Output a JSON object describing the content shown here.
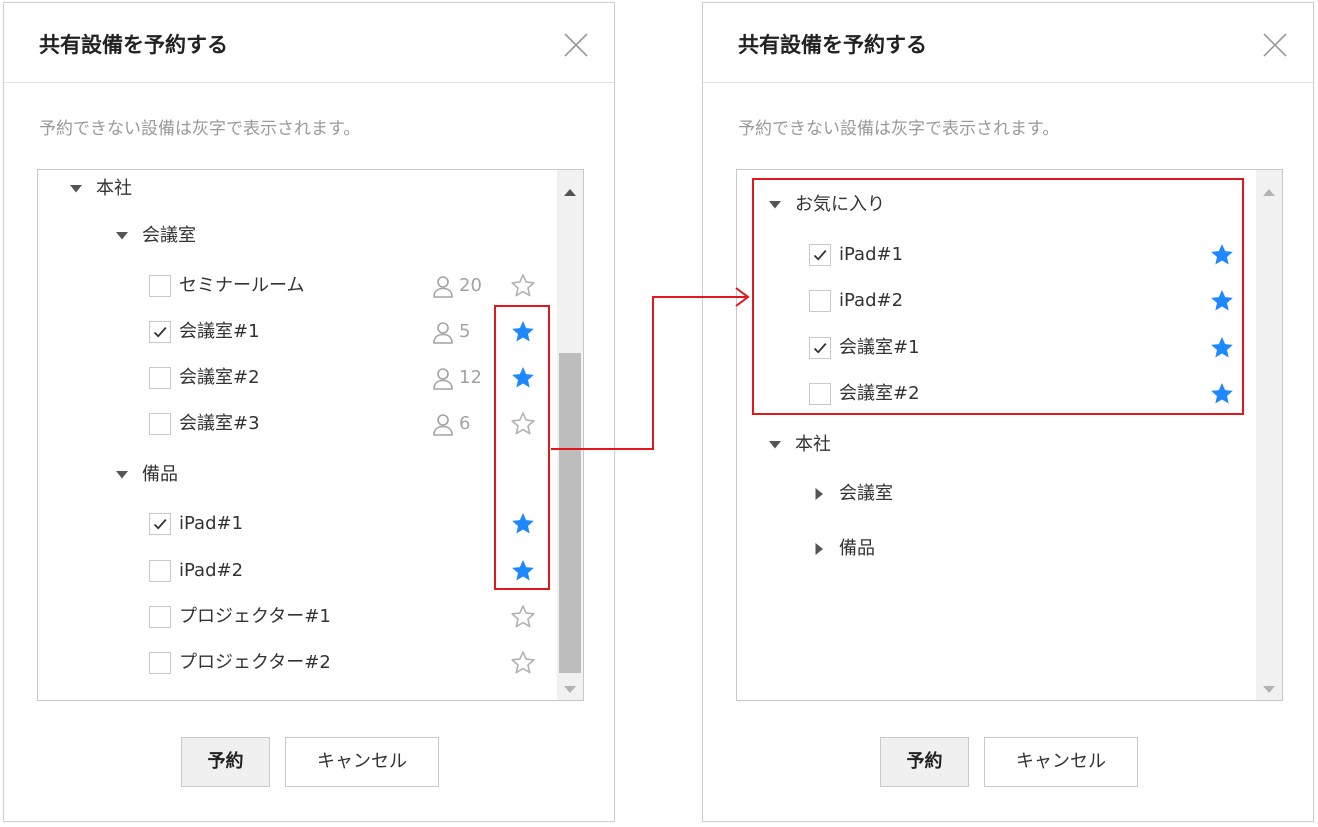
{
  "dialogs": {
    "left": {
      "title": "共有設備を予約する",
      "description": "予約できない設備は灰字で表示されます。",
      "tree": {
        "root": "本社",
        "groups": {
          "meeting_rooms": {
            "label": "会議室",
            "items": [
              {
                "label": "セミナールーム",
                "capacity": "20",
                "checked": false,
                "favorite": false
              },
              {
                "label": "会議室#1",
                "capacity": "5",
                "checked": true,
                "favorite": true
              },
              {
                "label": "会議室#2",
                "capacity": "12",
                "checked": false,
                "favorite": true
              },
              {
                "label": "会議室#3",
                "capacity": "6",
                "checked": false,
                "favorite": false
              }
            ]
          },
          "equipment": {
            "label": "備品",
            "items": [
              {
                "label": "iPad#1",
                "checked": true,
                "favorite": true
              },
              {
                "label": "iPad#2",
                "checked": false,
                "favorite": true
              },
              {
                "label": "プロジェクター#1",
                "checked": false,
                "favorite": false
              },
              {
                "label": "プロジェクター#2",
                "checked": false,
                "favorite": false
              }
            ]
          }
        }
      },
      "buttons": {
        "reserve": "予約",
        "cancel": "キャンセル"
      }
    },
    "right": {
      "title": "共有設備を予約する",
      "description": "予約できない設備は灰字で表示されます。",
      "tree": {
        "favorites": {
          "label": "お気に入り",
          "items": [
            {
              "label": "iPad#1",
              "checked": true,
              "favorite": true
            },
            {
              "label": "iPad#2",
              "checked": false,
              "favorite": true
            },
            {
              "label": "会議室#1",
              "checked": true,
              "favorite": true
            },
            {
              "label": "会議室#2",
              "checked": false,
              "favorite": true
            }
          ]
        },
        "root": "本社",
        "groups": {
          "meeting_rooms": {
            "label": "会議室"
          },
          "equipment": {
            "label": "備品"
          }
        }
      },
      "buttons": {
        "reserve": "予約",
        "cancel": "キャンセル"
      }
    }
  },
  "icons": {
    "close": "close-icon",
    "expanded": "caret-down-icon",
    "collapsed": "caret-right-icon",
    "check": "checkmark-icon",
    "capacity": "person-icon",
    "favorite_on": "star-filled-icon",
    "favorite_off": "star-outline-icon"
  },
  "colors": {
    "accent_star": "#1e88ff",
    "outline_star": "#b3b3b3",
    "highlight": "#e0181b"
  }
}
